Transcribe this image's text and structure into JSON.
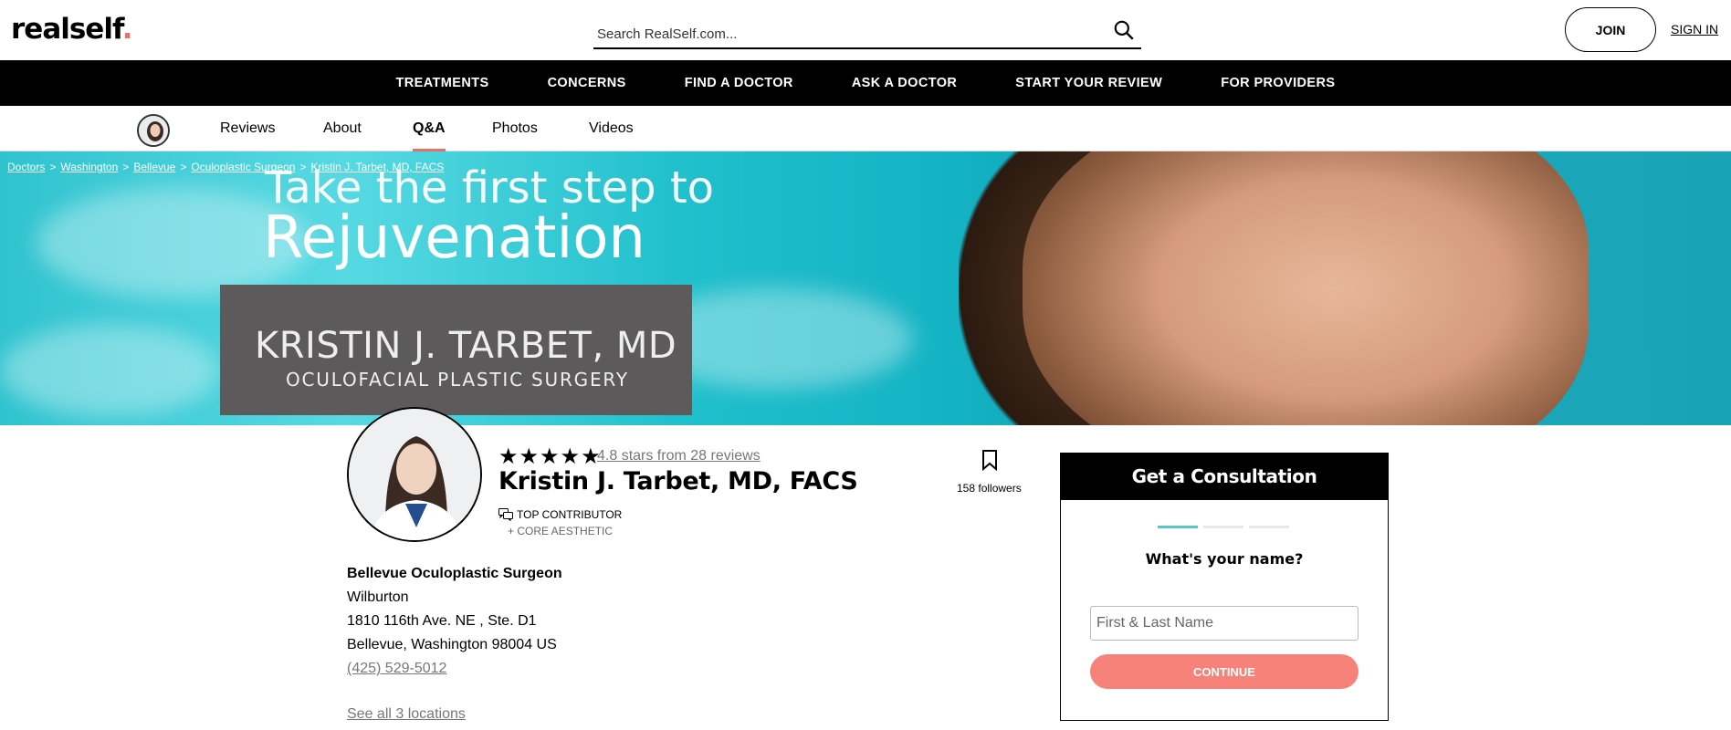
{
  "header": {
    "logo": "realself",
    "logo_dot": ".",
    "search_placeholder": "Search RealSelf.com...",
    "join_label": "JOIN",
    "signin_label": "SIGN IN"
  },
  "main_nav": [
    "TREATMENTS",
    "CONCERNS",
    "FIND A DOCTOR",
    "ASK A DOCTOR",
    "START YOUR REVIEW",
    "FOR PROVIDERS"
  ],
  "profile_tabs": [
    {
      "label": "Reviews",
      "active": false
    },
    {
      "label": "About",
      "active": false
    },
    {
      "label": "Q&A",
      "active": true
    },
    {
      "label": "Photos",
      "active": false
    },
    {
      "label": "Videos",
      "active": false
    }
  ],
  "breadcrumb": [
    "Doctors",
    "Washington",
    "Bellevue",
    "Oculoplastic Surgeon",
    "Kristin J. Tarbet, MD, FACS"
  ],
  "breadcrumb_sep": ">",
  "hero": {
    "line1": "Take the first step to",
    "line2": "Rejuvenation",
    "box_name": "KRISTIN J. TARBET, MD",
    "box_sub": "OCULOFACIAL PLASTIC SURGERY"
  },
  "profile": {
    "stars": "★★★★★",
    "rating_text": "4.8 stars from 28 reviews",
    "name": "Kristin J. Tarbet, MD, FACS",
    "top_contributor": "TOP CONTRIBUTOR",
    "aesthetic": "+ CORE AESTHETIC",
    "followers": "158 followers"
  },
  "address": {
    "practice": "Bellevue Oculoplastic Surgeon",
    "area": "Wilburton",
    "street": "1810 116th Ave. NE , Ste. D1",
    "city": "Bellevue, Washington 98004 US",
    "phone": "(425) 529-5012",
    "see_all": "See all 3 locations"
  },
  "consultation": {
    "title": "Get a Consultation",
    "question": "What's your name?",
    "input_placeholder": "First & Last Name",
    "button": "CONTINUE",
    "progress": [
      true,
      false,
      false
    ]
  },
  "colors": {
    "accent": "#e8706a",
    "button": "#f6827a",
    "progress": "#5cc7c0"
  }
}
